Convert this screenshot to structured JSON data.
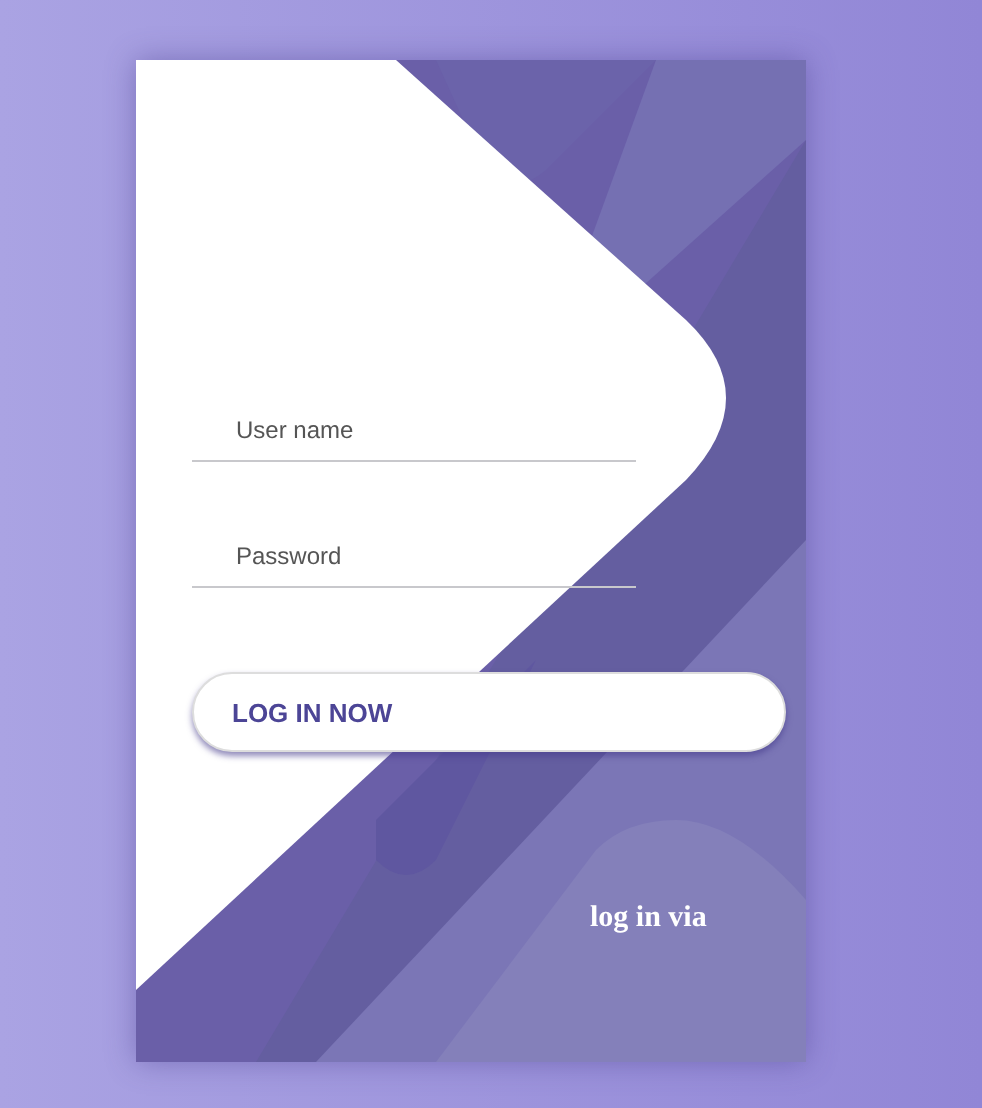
{
  "fields": [
    {
      "placeholder": "User name"
    },
    {
      "placeholder": "Password"
    }
  ],
  "login_button": {
    "label": "LOG IN NOW"
  },
  "footer": {
    "text": "log in via"
  }
}
